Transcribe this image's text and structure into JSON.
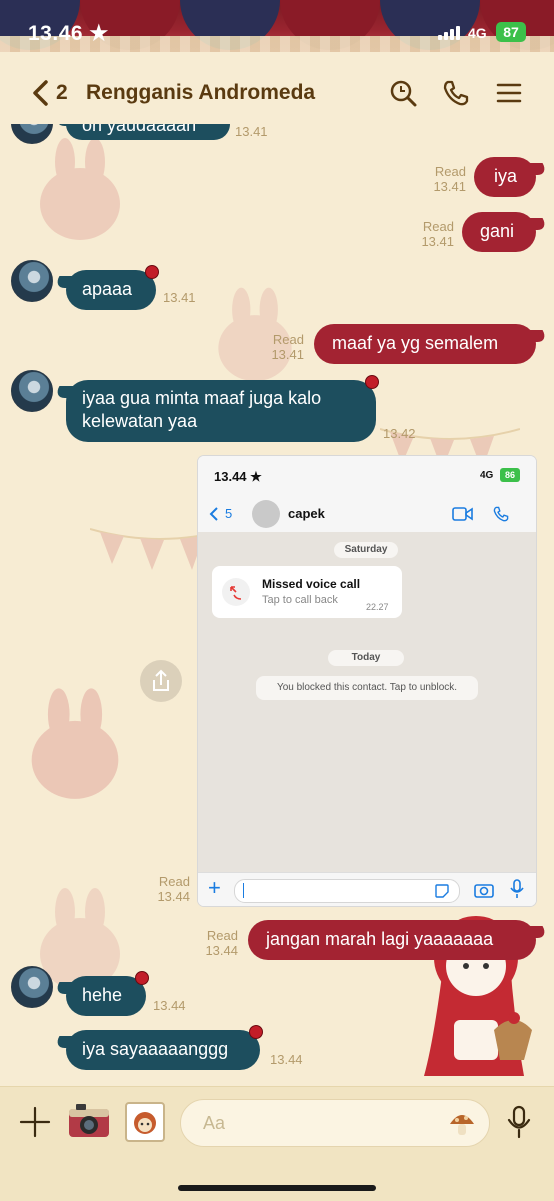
{
  "status_bar": {
    "time": "13.46",
    "network": "4G",
    "battery": "87"
  },
  "header": {
    "back_count": "2",
    "title": "Rengganis Andromeda"
  },
  "messages": [
    {
      "dir": "in",
      "text": "oh yaudaaaah",
      "time": "13.41"
    },
    {
      "dir": "out",
      "text": "iya",
      "read": "Read",
      "time": "13.41"
    },
    {
      "dir": "out",
      "text": "gani",
      "read": "Read",
      "time": "13.41"
    },
    {
      "dir": "in",
      "text": "apaaa",
      "time": "13.41"
    },
    {
      "dir": "out",
      "text": "maaf ya yg semalem",
      "read": "Read",
      "time": "13.41"
    },
    {
      "dir": "in",
      "line1": "iyaa gua minta maaf juga kalo",
      "line2": "kelewatan yaa",
      "time": "13.42"
    },
    {
      "dir": "out",
      "type": "image",
      "read": "Read",
      "time": "13.44"
    },
    {
      "dir": "out",
      "text": "jangan marah lagi yaaaaaaa",
      "read": "Read",
      "time": "13.44"
    },
    {
      "dir": "in",
      "text": "hehe",
      "time": "13.44"
    },
    {
      "dir": "in",
      "text": "iya sayaaaaanggg",
      "time": "13.44"
    }
  ],
  "screenshot": {
    "status_time": "13.44 ★",
    "network": "4G",
    "battery": "86",
    "back_count": "5",
    "contact": "capek",
    "date1": "Saturday",
    "call_title": "Missed voice call",
    "call_sub": "Tap to call back",
    "call_time": "22.27",
    "date2": "Today",
    "blocked_notice": "You blocked this contact. Tap to unblock."
  },
  "composer": {
    "placeholder": "Aa"
  },
  "colors": {
    "incoming": "#1d4e5e",
    "outgoing": "#a32332",
    "background": "#f7ecd3",
    "header_text": "#5a3a10"
  }
}
